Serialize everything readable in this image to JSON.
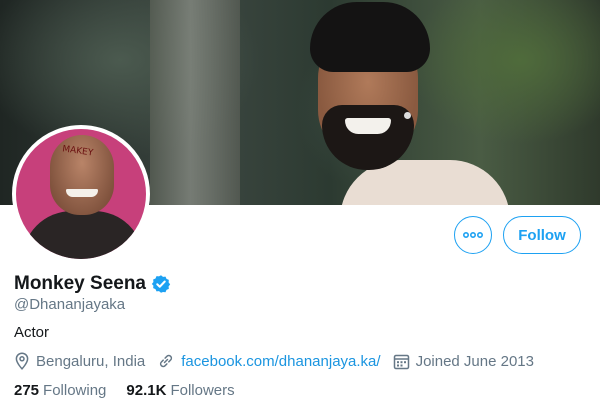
{
  "profile": {
    "display_name": "Monkey Seena",
    "handle": "@Dhananjayaka",
    "bio": "Actor",
    "verified_icon": "verified-badge-icon",
    "avatar_text": "MAKEY"
  },
  "actions": {
    "more_icon": "more-dots-icon",
    "follow_label": "Follow"
  },
  "meta": {
    "location": "Bengaluru, India",
    "website": "facebook.com/dhananjaya.ka/",
    "joined": "Joined June 2013"
  },
  "stats": {
    "following_count": "275",
    "following_label": "Following",
    "followers_count": "92.1K",
    "followers_label": "Followers"
  },
  "colors": {
    "accent": "#1da1f2",
    "link": "#1b95e0",
    "secondary_text": "#657786"
  }
}
